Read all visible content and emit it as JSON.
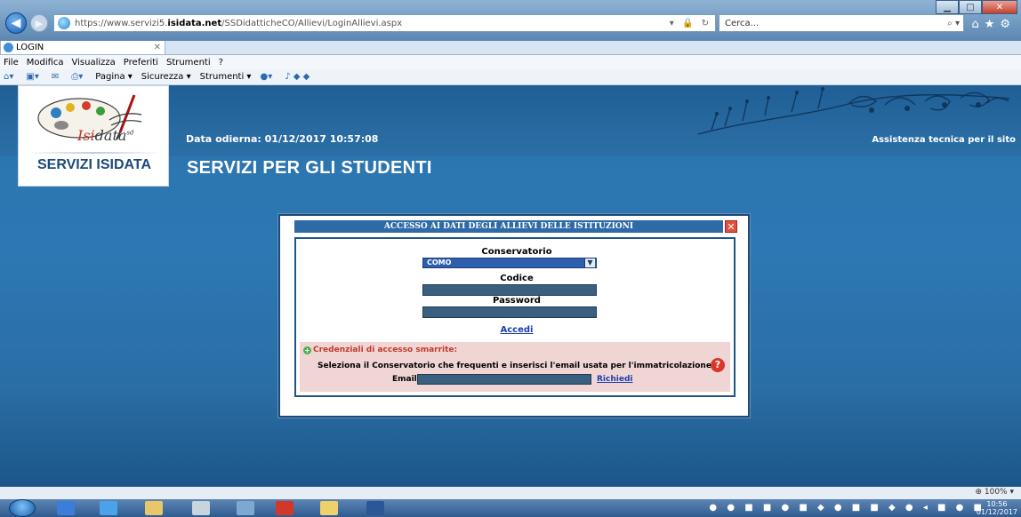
{
  "browser": {
    "url_prefix": "https://www.servizi5.",
    "url_host": "isidata.net",
    "url_path": "/SSDidatticheCO/Allievi/LoginAllievi.aspx",
    "search_placeholder": "Cerca...",
    "tab_title": "LOGIN",
    "menu": [
      "File",
      "Modifica",
      "Visualizza",
      "Preferiti",
      "Strumenti",
      "?"
    ],
    "commands": [
      "Pagina ▾",
      "Sicurezza ▾",
      "Strumenti ▾"
    ],
    "zoom": "100%"
  },
  "header": {
    "logo_brand": "data",
    "logo_brand_prefix_a": "Is",
    "logo_brand_prefix_b": "i",
    "logo_sup": "sd",
    "logo_caption": "SERVIZI ISIDATA",
    "date_line": "Data odierna: 01/12/2017 10:57:08",
    "support_link": "Assistenza tecnica per il sito",
    "page_title": "SERVIZI PER GLI STUDENTI"
  },
  "dialog": {
    "title": "ACCESSO AI DATI DEGLI ALLIEVI DELLE ISTITUZIONI",
    "close": "✕",
    "conservatorio_label": "Conservatorio",
    "conservatorio_value": "COMO",
    "codice_label": "Codice",
    "password_label": "Password",
    "submit_link": "Accedi",
    "recovery": {
      "title": "Credenziali di accesso smarrite:",
      "text": "Seleziona il Conservatorio che frequenti e inserisci l'email usata per l'immatricolazione",
      "email_label": "Email:",
      "request_link": "Richiedi",
      "help": "?"
    }
  },
  "taskbar": {
    "clock_time": "10:56",
    "clock_date": "01/12/2017"
  },
  "colors": {
    "page_blue": "#2a73ad",
    "dialog_header": "#2e6aa6",
    "recovery_bg": "#f0d5d5",
    "link_blue": "#1a3fae",
    "accent_red": "#c0392b"
  }
}
